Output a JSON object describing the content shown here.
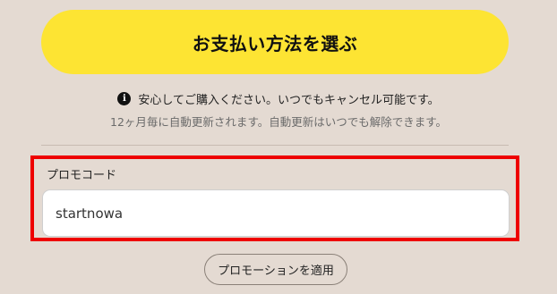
{
  "payment": {
    "select_button_label": "お支払い方法を選ぶ"
  },
  "notice": {
    "icon": "info-icon",
    "line1": "安心してご購入ください。いつでもキャンセル可能です。",
    "line2": "12ヶ月毎に自動更新されます。自動更新はいつでも解除できます。"
  },
  "promo": {
    "label": "プロモコード",
    "input_value": "startnowa",
    "apply_button_label": "プロモーションを適用"
  },
  "colors": {
    "background": "#e4dad2",
    "pay_button": "#fde433",
    "highlight": "#ee0000"
  }
}
